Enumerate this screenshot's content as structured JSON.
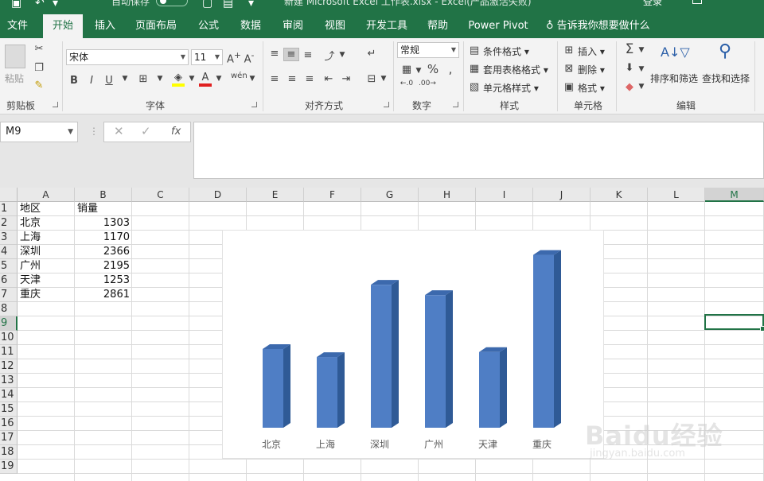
{
  "titlebar": {
    "autosave": "自动保存",
    "autosave_state": "关",
    "doc_title": "新建 Microsoft Excel 工作表.xlsx  -  Excel(产品激活失败)",
    "login": "登录"
  },
  "tabs": [
    "文件",
    "开始",
    "插入",
    "页面布局",
    "公式",
    "数据",
    "审阅",
    "视图",
    "开发工具",
    "帮助",
    "Power Pivot"
  ],
  "tell_me": "告诉我你想要做什么",
  "ribbon": {
    "clipboard": {
      "label": "剪贴板",
      "paste": "粘贴"
    },
    "font": {
      "label": "字体",
      "name": "宋体",
      "size": "11"
    },
    "alignment": {
      "label": "对齐方式"
    },
    "number": {
      "label": "数字",
      "format": "常规"
    },
    "styles": {
      "label": "样式",
      "cond": "条件格式",
      "table": "套用表格格式",
      "cell": "单元格样式"
    },
    "cells": {
      "label": "单元格",
      "insert": "插入",
      "delete": "删除",
      "format": "格式"
    },
    "editing": {
      "label": "编辑",
      "sort": "排序和筛选",
      "find": "查找和选择"
    }
  },
  "formula_bar": {
    "name_box": "M9",
    "fx": "fx",
    "value": ""
  },
  "columns": [
    "A",
    "B",
    "C",
    "D",
    "E",
    "F",
    "G",
    "H",
    "I",
    "J",
    "K",
    "L",
    "M"
  ],
  "selected_column": "M",
  "rows": [
    "1",
    "2",
    "3",
    "4",
    "5",
    "6",
    "7",
    "8",
    "9",
    "10",
    "11",
    "12",
    "13",
    "14",
    "15",
    "16",
    "17",
    "18",
    "19"
  ],
  "selected_row": "9",
  "cells": {
    "header": [
      "地区",
      "销量"
    ],
    "data": [
      [
        "北京",
        "1303"
      ],
      [
        "上海",
        "1170"
      ],
      [
        "深圳",
        "2366"
      ],
      [
        "广州",
        "2195"
      ],
      [
        "天津",
        "1253"
      ],
      [
        "重庆",
        "2861"
      ]
    ]
  },
  "chart_data": {
    "type": "bar",
    "categories": [
      "北京",
      "上海",
      "深圳",
      "广州",
      "天津",
      "重庆"
    ],
    "values": [
      1303,
      1170,
      2366,
      2195,
      1253,
      2861
    ],
    "title": "",
    "xlabel": "",
    "ylabel": "",
    "ylim": [
      0,
      3000
    ],
    "grid": false,
    "bar_color": "#4f7ec5",
    "bar_side_color": "#2f5a96",
    "bar_top_color": "#3c69ad"
  },
  "watermark": {
    "brand": "Baidu经验",
    "url": "jingyan.baidu.com"
  },
  "colors": {
    "excel_green": "#217346"
  }
}
